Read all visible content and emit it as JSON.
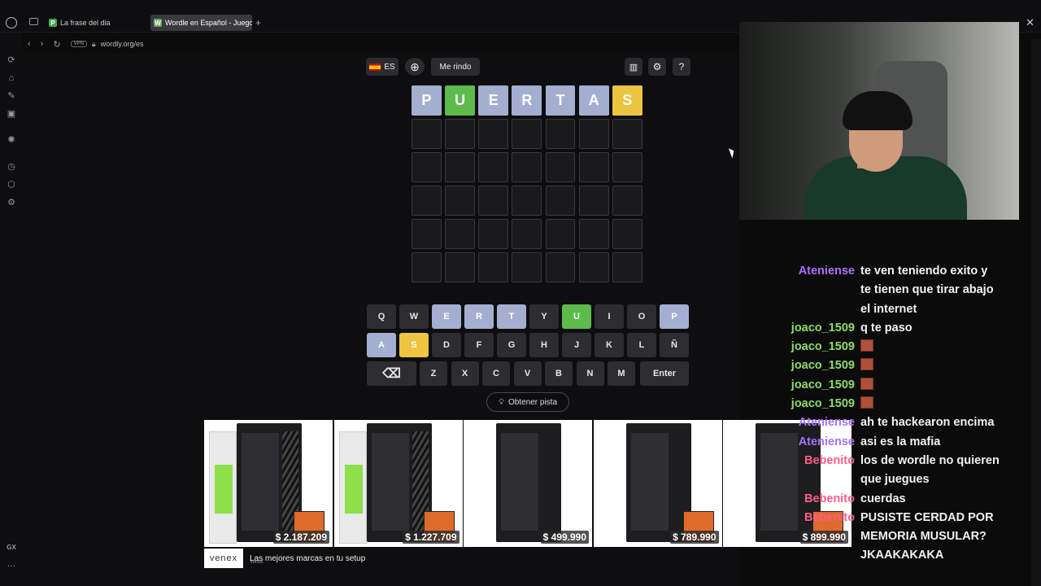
{
  "tabs": [
    {
      "label": "La frase del dia",
      "favicon": "P",
      "favcolor": "#3fae49"
    },
    {
      "label": "Wordle en Español - Juego",
      "favicon": "W",
      "favcolor": "#6aaa64"
    }
  ],
  "address": {
    "url": "wordly.org/es",
    "vpn": "VPN"
  },
  "game": {
    "lang": "ES",
    "giveup": "Me rindo",
    "hint": "Obtener pista",
    "rows": [
      [
        {
          "l": "P",
          "s": "gray"
        },
        {
          "l": "U",
          "s": "green"
        },
        {
          "l": "E",
          "s": "gray"
        },
        {
          "l": "R",
          "s": "gray"
        },
        {
          "l": "T",
          "s": "gray"
        },
        {
          "l": "A",
          "s": "gray"
        },
        {
          "l": "S",
          "s": "yellow"
        }
      ],
      [],
      [],
      [],
      [],
      []
    ],
    "keyboard": {
      "row1": [
        {
          "k": "Q",
          "s": ""
        },
        {
          "k": "W",
          "s": ""
        },
        {
          "k": "E",
          "s": "gray"
        },
        {
          "k": "R",
          "s": "gray"
        },
        {
          "k": "T",
          "s": "gray"
        },
        {
          "k": "Y",
          "s": ""
        },
        {
          "k": "U",
          "s": "green"
        },
        {
          "k": "I",
          "s": ""
        },
        {
          "k": "O",
          "s": ""
        },
        {
          "k": "P",
          "s": "gray"
        }
      ],
      "row2": [
        {
          "k": "A",
          "s": "gray"
        },
        {
          "k": "S",
          "s": "yellow"
        },
        {
          "k": "D",
          "s": ""
        },
        {
          "k": "F",
          "s": ""
        },
        {
          "k": "G",
          "s": ""
        },
        {
          "k": "H",
          "s": ""
        },
        {
          "k": "J",
          "s": ""
        },
        {
          "k": "K",
          "s": ""
        },
        {
          "k": "L",
          "s": ""
        },
        {
          "k": "Ñ",
          "s": ""
        }
      ],
      "row3": [
        "Z",
        "X",
        "C",
        "V",
        "B",
        "N",
        "M"
      ],
      "enter": "Enter"
    }
  },
  "ads": {
    "prices": [
      "$ 2.187.209",
      "$ 1.227.709",
      "$ 499.990",
      "$ 789.990",
      "$ 899.990"
    ],
    "brand": "venex",
    "tagline": "Las mejores marcas en tu setup",
    "sub": "Venex"
  },
  "sidebar": {
    "gx": "GX"
  },
  "chat": [
    {
      "user": "Ateniense",
      "color": "#a970ff",
      "text": "te ven teniendo exito y\nte tienen que tirar abajo\nel internet"
    },
    {
      "user": "joaco_1509",
      "color": "#8fdc6a",
      "text": "q te paso"
    },
    {
      "user": "joaco_1509",
      "color": "#8fdc6a",
      "emote": true
    },
    {
      "user": "joaco_1509",
      "color": "#8fdc6a",
      "emote": true
    },
    {
      "user": "joaco_1509",
      "color": "#8fdc6a",
      "emote": true
    },
    {
      "user": "joaco_1509",
      "color": "#8fdc6a",
      "emote": true
    },
    {
      "user": "Ateniense",
      "color": "#a970ff",
      "text": "ah te hackearon encima"
    },
    {
      "user": "Ateniense",
      "color": "#a970ff",
      "text": "asi es la mafia"
    },
    {
      "user": "Bebenito",
      "color": "#ff5c8a",
      "text": "los de wordle no quieren\nque juegues"
    },
    {
      "user": "Bebenito",
      "color": "#ff5c8a",
      "text": "cuerdas"
    },
    {
      "user": "Bebenito",
      "color": "#ff5c8a",
      "text": "PUSISTE CERDAD POR\nMEMORIA MUSULAR?\nJKAAKAKAKA"
    }
  ]
}
